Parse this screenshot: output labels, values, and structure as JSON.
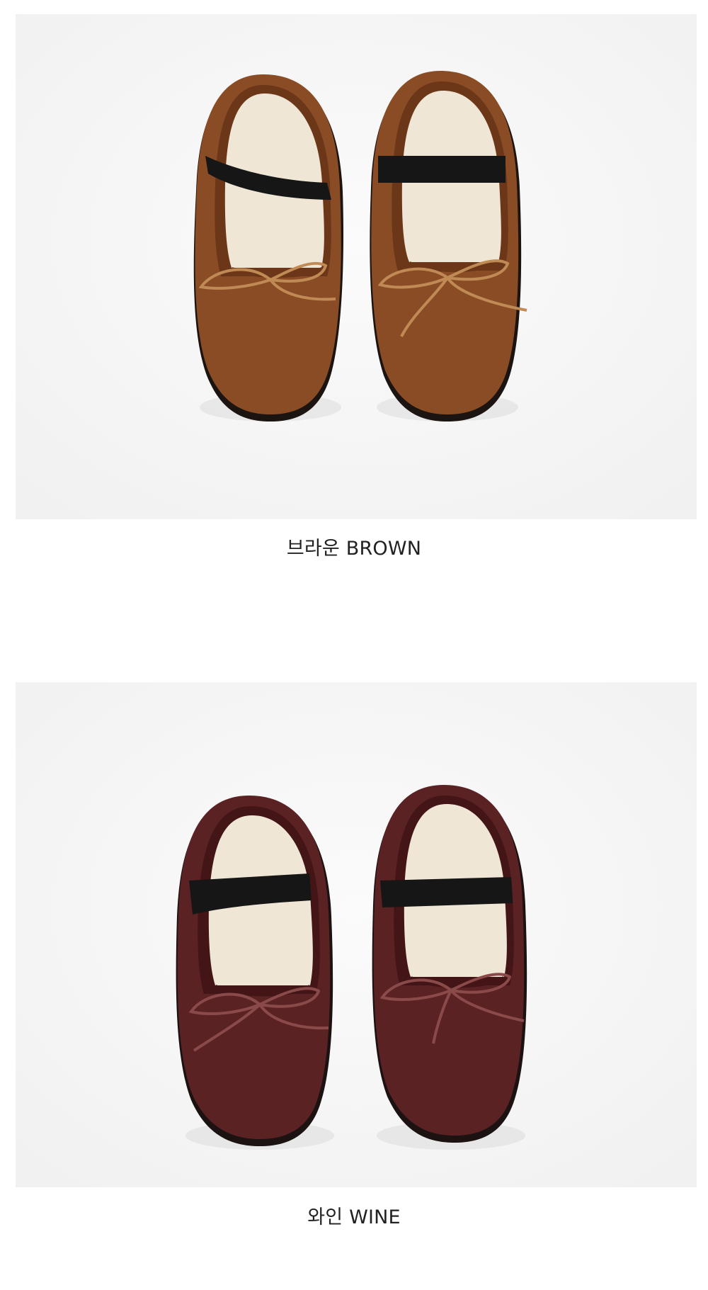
{
  "products": [
    {
      "caption": "브라운 BROWN",
      "colors": {
        "suede": "#8a4c24",
        "suede_shadow": "#6b3718",
        "lace": "#c08a55",
        "lining": "#f0e6d6",
        "strap": "#161616",
        "sole": "#1b1410"
      }
    },
    {
      "caption": "와인 WINE",
      "colors": {
        "suede": "#5b2224",
        "suede_shadow": "#431517",
        "lace": "#8a4a4a",
        "lining": "#f0e6d6",
        "strap": "#161616",
        "sole": "#1c1212"
      }
    }
  ],
  "background_color": "#f6f6f6"
}
